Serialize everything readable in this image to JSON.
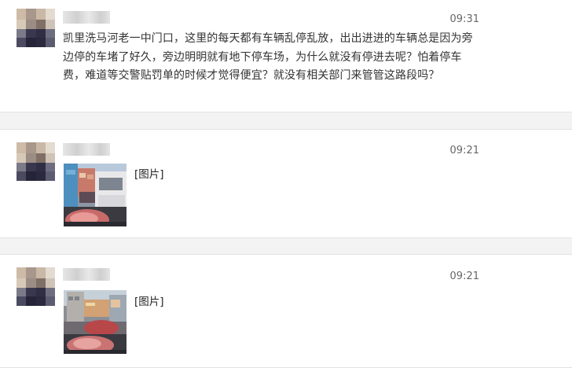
{
  "messages": [
    {
      "time": "09:31",
      "text": "凯里洗马河老一中门口，这里的每天都有车辆乱停乱放，出出进进的车辆总是因为旁边停的车堵了好久，旁边明明就有地下停车场，为什么就没有停进去呢？怕着停车费，难道等交警贴罚单的时候才觉得便宜？就没有相关部门来管管这路段吗？"
    },
    {
      "time": "09:21",
      "image_label": "[图片]"
    },
    {
      "time": "09:21",
      "image_label": "[图片]"
    }
  ]
}
